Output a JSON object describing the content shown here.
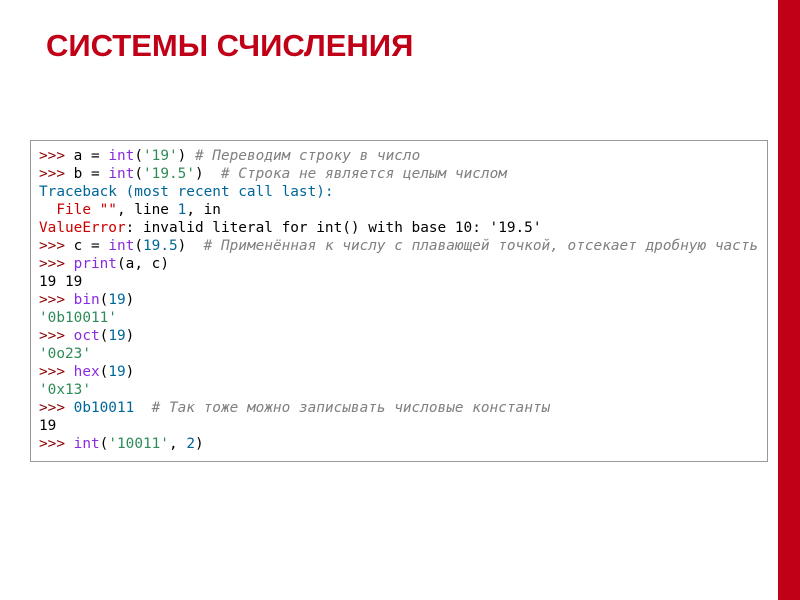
{
  "title": "СИСТЕМЫ СЧИСЛЕНИЯ",
  "code": {
    "l1": {
      "prompt": ">>> ",
      "v1": "a",
      "eq": " = ",
      "fn": "int",
      "op": "(",
      "arg": "'19'",
      "cp": ") ",
      "cmt": "# Переводим строку в число"
    },
    "l2": {
      "prompt": ">>> ",
      "v1": "b",
      "eq": " = ",
      "fn": "int",
      "op": "(",
      "arg": "'19.5'",
      "cp": ")  ",
      "cmt": "# Строка не является целым числом"
    },
    "l3": "Traceback (most recent call last):",
    "l4a": "  File \"\"",
    "l4b": ", line ",
    "l4c": "1",
    "l4d": ", in",
    "l5a": "ValueError",
    "l5b": ": invalid literal for int() with base 10: '19.5'",
    "l6": {
      "prompt": ">>> ",
      "v1": "c",
      "eq": " = ",
      "fn": "int",
      "op": "(",
      "arg": "19.5",
      "cp": ")  ",
      "cmt": "# Применённая к числу с плавающей точкой, отсекает дробную часть"
    },
    "l7": {
      "prompt": ">>> ",
      "fn": "print",
      "op": "(",
      "a1": "a",
      "sep": ", ",
      "a2": "c",
      "cp": ")"
    },
    "l8": "19 19",
    "l9": {
      "prompt": ">>> ",
      "fn": "bin",
      "op": "(",
      "arg": "19",
      "cp": ")"
    },
    "l10": "'0b10011'",
    "l11": {
      "prompt": ">>> ",
      "fn": "oct",
      "op": "(",
      "arg": "19",
      "cp": ")"
    },
    "l12": "'0o23'",
    "l13": {
      "prompt": ">>> ",
      "fn": "hex",
      "op": "(",
      "arg": "19",
      "cp": ")"
    },
    "l14": "'0x13'",
    "l15": {
      "prompt": ">>> ",
      "val": "0b10011",
      "sp": "  ",
      "cmt": "# Так тоже можно записывать числовые константы"
    },
    "l16": "19",
    "l17": {
      "prompt": ">>> ",
      "fn": "int",
      "op": "(",
      "a1": "'10011'",
      "sep": ", ",
      "a2": "2",
      "cp": ")"
    }
  }
}
